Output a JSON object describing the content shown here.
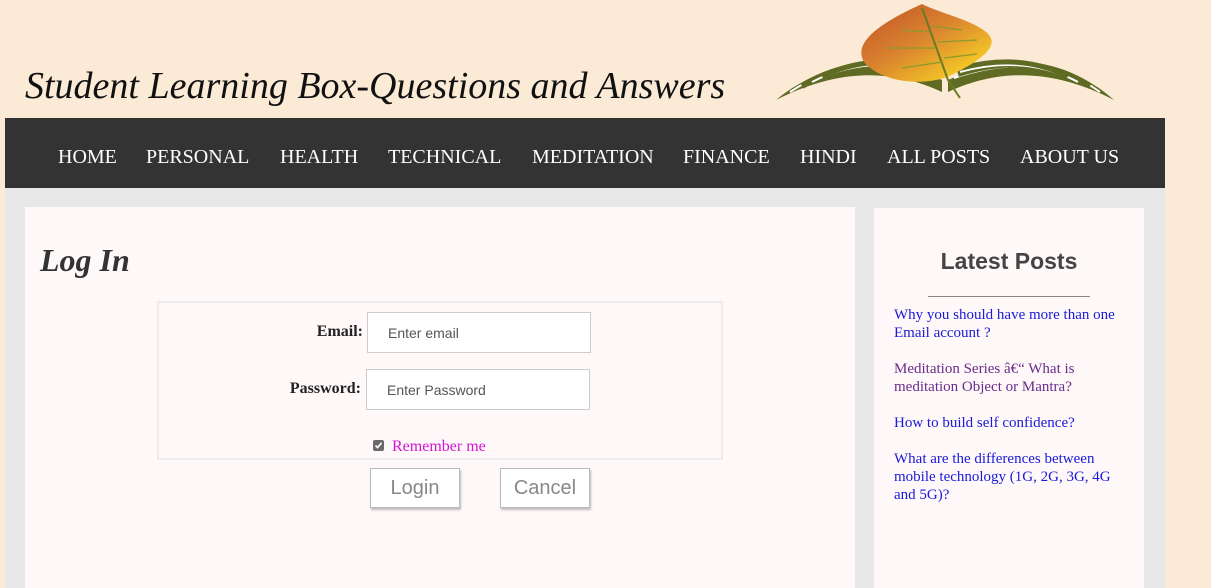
{
  "header": {
    "site_title": "Student Learning Box-Questions and Answers"
  },
  "nav": {
    "items": [
      "HOME",
      "PERSONAL",
      "HEALTH",
      "TECHNICAL",
      "MEDITATION",
      "FINANCE",
      "HINDI",
      "ALL POSTS",
      "ABOUT US"
    ]
  },
  "login": {
    "title": "Log In",
    "email_label": "Email:",
    "email_placeholder": "Enter email",
    "password_label": "Password:",
    "password_placeholder": "Enter Password",
    "remember_label": "Remember me",
    "remember_checked": true,
    "login_button": "Login",
    "cancel_button": "Cancel"
  },
  "sidebar": {
    "title": "Latest Posts",
    "posts": [
      {
        "title": "Why you should have more than one Email account ?",
        "color": "#1a1ad8"
      },
      {
        "title": "Meditation Series â€“ What is meditation Object or Mantra?",
        "color": "#6a2b8c"
      },
      {
        "title": "How to build self confidence?",
        "color": "#1a1ad8"
      },
      {
        "title": "What are the differences between mobile technology (1G, 2G, 3G, 4G and 5G)?",
        "color": "#1a1ad8"
      }
    ]
  },
  "colors": {
    "page_background": "#fbead6",
    "nav_background": "#333333",
    "remember_label": "#d414d4"
  }
}
